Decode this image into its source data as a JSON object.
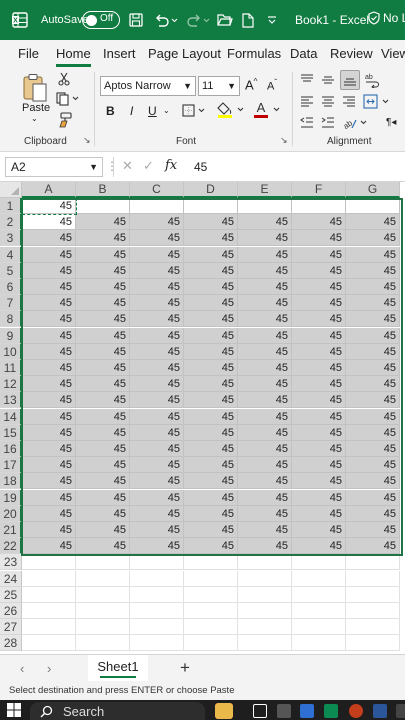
{
  "titlebar": {
    "autosave_label": "AutoSave",
    "autosave_state": "Off",
    "doc_title": "Book1 - Excel",
    "label_badge": "No L",
    "icons": [
      "excel-icon",
      "save-icon",
      "undo-icon",
      "redo-icon",
      "open-folder-icon",
      "new-file-icon",
      "customize-qat-icon",
      "shield-icon"
    ]
  },
  "menu": {
    "tabs": [
      "File",
      "Home",
      "Insert",
      "Page Layout",
      "Formulas",
      "Data",
      "Review",
      "View"
    ],
    "active": "Home"
  },
  "ribbon": {
    "clipboard": {
      "paste": "Paste",
      "label": "Clipboard"
    },
    "font": {
      "name": "Aptos Narrow",
      "size": "11",
      "label": "Font",
      "bold": "B",
      "italic": "I",
      "underline": "U"
    },
    "alignment": {
      "label": "Alignment"
    },
    "accent_font_color": "#c00000",
    "accent_fill_color": "#ffff00"
  },
  "formula_bar": {
    "name_box": "A2",
    "fx_label": "fx",
    "value": "45"
  },
  "grid": {
    "columns": [
      "A",
      "B",
      "C",
      "D",
      "E",
      "F",
      "G"
    ],
    "rows": [
      "1",
      "2",
      "3",
      "4",
      "5",
      "6",
      "7",
      "8",
      "9",
      "10",
      "11",
      "12",
      "13",
      "14",
      "15",
      "16",
      "17",
      "18",
      "19",
      "20",
      "21",
      "22",
      "23",
      "24",
      "25",
      "26",
      "27",
      "28"
    ],
    "cell_value": "45",
    "filled_rows_from": 2,
    "filled_rows_to": 22,
    "copied_cell": "A1",
    "active_cell": "A2"
  },
  "sheets": {
    "tabs": [
      "Sheet1"
    ],
    "add_label": "+"
  },
  "status": {
    "text": "Select destination and press ENTER or choose Paste"
  },
  "taskbar": {
    "search": "Search"
  },
  "colors": {
    "brand": "#107c41",
    "selection": "#d0d0d0"
  }
}
